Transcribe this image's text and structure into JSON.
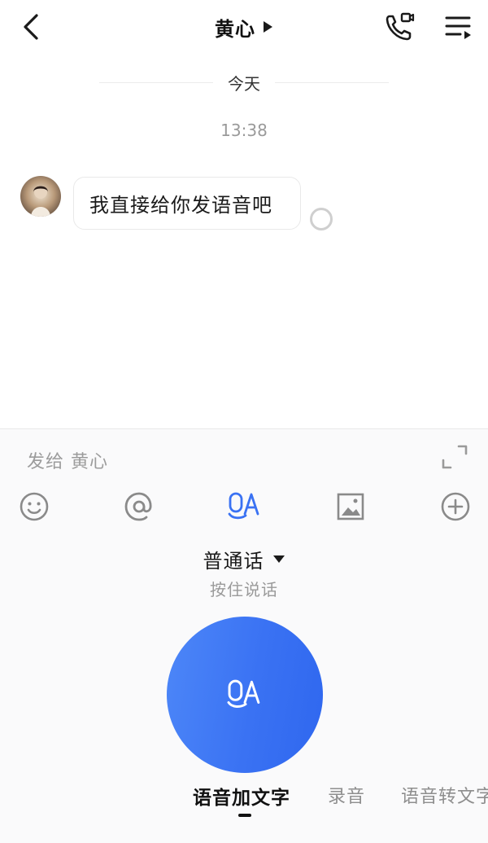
{
  "header": {
    "title": "黄心",
    "back_icon": "chevron-left-icon",
    "title_caret_icon": "caret-right-icon",
    "phone_icon": "phone-video-icon",
    "menu_icon": "menu-icon"
  },
  "chat": {
    "date_label": "今天",
    "time_label": "13:38",
    "messages": [
      {
        "text": "我直接给你发语音吧",
        "status": "unread"
      }
    ]
  },
  "input_panel": {
    "placeholder": "发给 黄心",
    "expand_icon": "expand-icon",
    "tools": [
      "emoji-icon",
      "at-icon",
      "voice-text-icon",
      "image-icon",
      "plus-icon"
    ],
    "language": "普通话",
    "hold_hint": "按住说话",
    "mode_tabs": [
      {
        "label": "语音加文字",
        "active": true
      },
      {
        "label": "录音",
        "active": false
      },
      {
        "label": "语音转文字",
        "active": false
      }
    ]
  },
  "colors": {
    "accent": "#3a72f3",
    "panel_bg": "#fafafb",
    "muted_text": "#9a9a9a"
  }
}
